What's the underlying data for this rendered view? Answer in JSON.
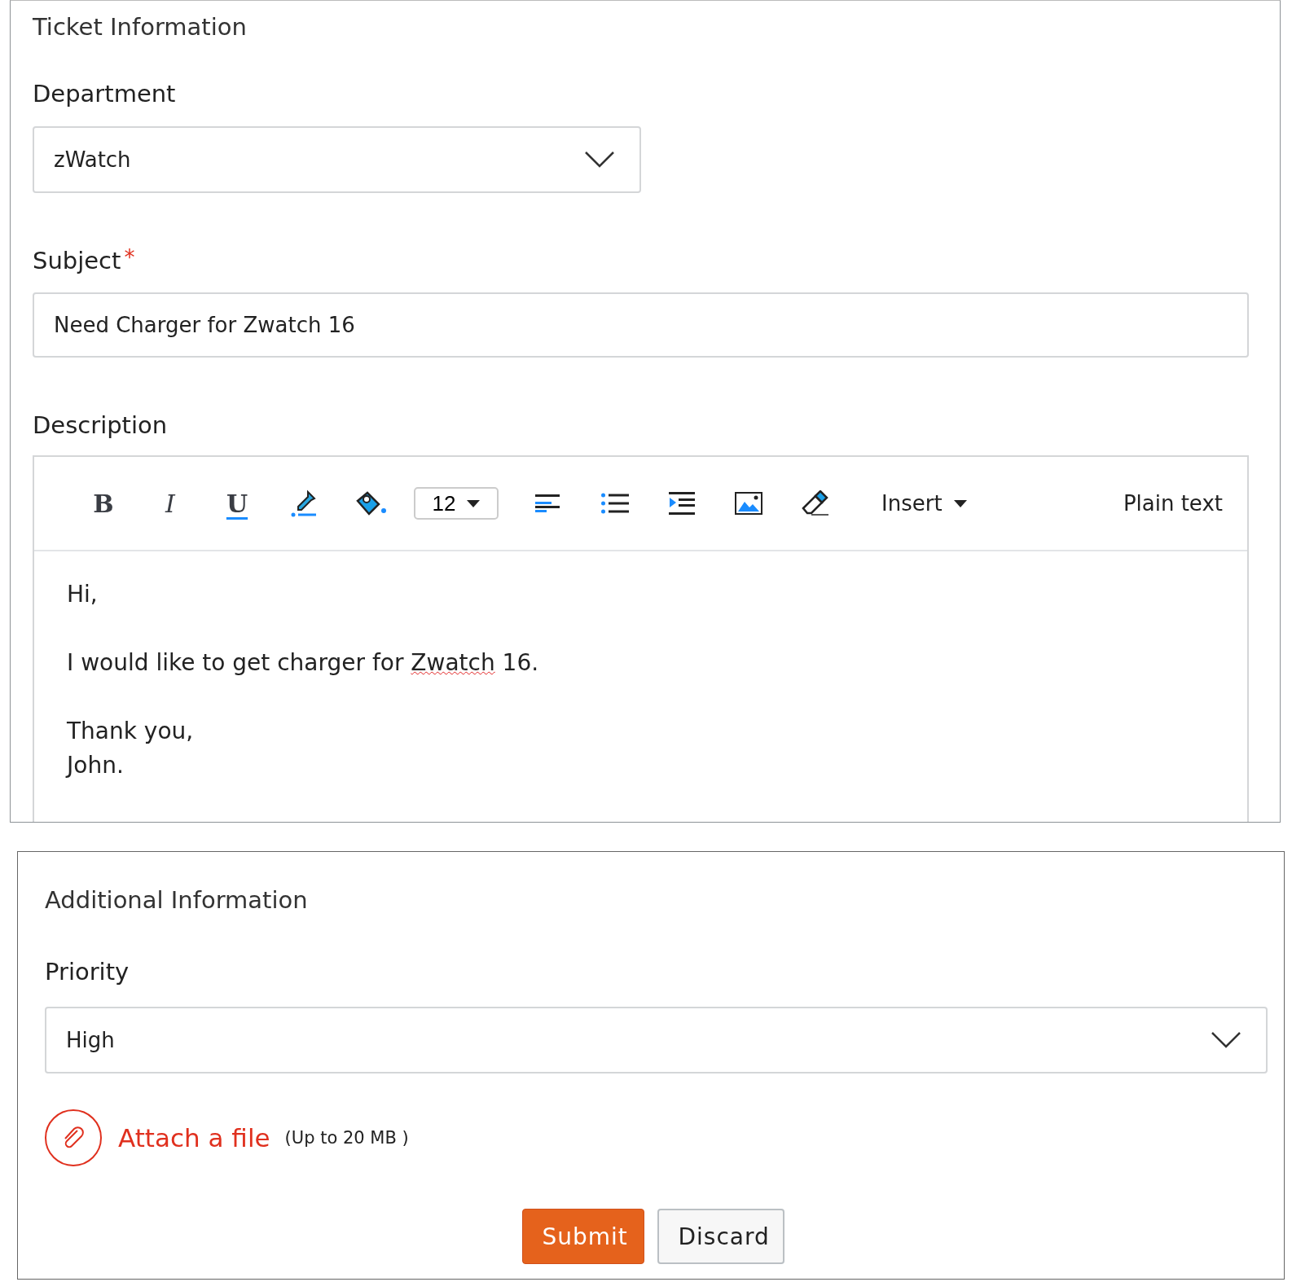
{
  "ticket_information": {
    "title": "Ticket Information",
    "department": {
      "label": "Department",
      "value": "zWatch"
    },
    "subject": {
      "label": "Subject",
      "required": true,
      "required_mark": "*",
      "value": "Need Charger for Zwatch 16"
    },
    "description": {
      "label": "Description",
      "toolbar": [
        {
          "kind": "bold",
          "label": "B"
        },
        {
          "kind": "italic",
          "label": "I"
        },
        {
          "kind": "underline",
          "label": "U"
        },
        {
          "kind": "text-color"
        },
        {
          "kind": "fill-color"
        },
        {
          "kind": "size-select",
          "label": "12"
        },
        {
          "kind": "align"
        },
        {
          "kind": "list"
        },
        {
          "kind": "indent"
        },
        {
          "kind": "image"
        },
        {
          "kind": "eraser"
        },
        {
          "kind": "menu",
          "label": "Insert"
        },
        {
          "kind": "mode",
          "label": "Plain text"
        }
      ],
      "paragraphs": [
        [
          {
            "text": "Hi,",
            "misspelled": false
          }
        ],
        [
          {
            "text": "I would like to get charger for ",
            "misspelled": false
          },
          {
            "text": "Zwatch",
            "misspelled": true
          },
          {
            "text": " 16.",
            "misspelled": false
          }
        ],
        [
          {
            "text": "Thank you,",
            "misspelled": false
          }
        ],
        [
          {
            "text": "John.",
            "misspelled": false
          }
        ]
      ]
    }
  },
  "additional_information": {
    "title": "Additional Information",
    "priority": {
      "label": "Priority",
      "value": "High"
    },
    "attach": {
      "label": "Attach a file",
      "limit": "(Up to 20 MB )"
    },
    "buttons": [
      {
        "label": "Submit",
        "kind": "primary"
      },
      {
        "label": "Discard",
        "kind": "secondary"
      }
    ]
  }
}
